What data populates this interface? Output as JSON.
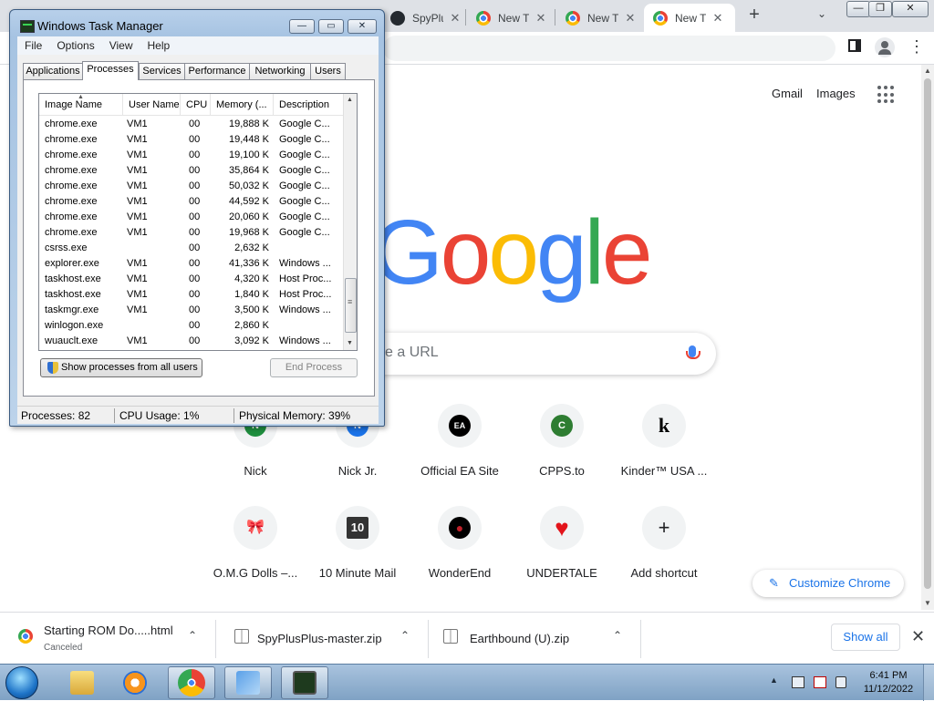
{
  "browser": {
    "tabs": [
      {
        "title": "SpyPlu",
        "icon": "github-icon",
        "active": false
      },
      {
        "title": "New T",
        "icon": "chrome-icon",
        "active": false
      },
      {
        "title": "New T",
        "icon": "chrome-icon",
        "active": false
      },
      {
        "title": "New T",
        "icon": "chrome-icon",
        "active": true
      }
    ],
    "new_tab": "+",
    "tab_close": "✕",
    "tab_search": "⌄",
    "window_controls": {
      "minimize": "—",
      "maximize": "❐",
      "close": "✕"
    },
    "menu": "⋮"
  },
  "ntp": {
    "gmail": "Gmail",
    "images": "Images",
    "logo_letters": [
      {
        "ch": "G",
        "color": "#4285f4"
      },
      {
        "ch": "o",
        "color": "#ea4335"
      },
      {
        "ch": "o",
        "color": "#fbbc05"
      },
      {
        "ch": "g",
        "color": "#4285f4"
      },
      {
        "ch": "l",
        "color": "#34a853"
      },
      {
        "ch": "e",
        "color": "#ea4335"
      }
    ],
    "search_placeholder": "e a URL",
    "shortcuts": [
      {
        "label": "Nick",
        "icon": "n-letter-icon",
        "letter": "N",
        "color": "#1e8e3e"
      },
      {
        "label": "Nick Jr.",
        "icon": "nick-jr-icon",
        "letter": "N",
        "color": "#1a73e8"
      },
      {
        "label": "Official EA Site",
        "icon": "ea-icon",
        "letter": "EA",
        "color": "#000000"
      },
      {
        "label": "CPPS.to",
        "icon": "c-letter-icon",
        "letter": "C",
        "color": "#2e7d32"
      },
      {
        "label": "Kinder™ USA ...",
        "icon": "kinder-icon",
        "letter": "k",
        "color": "#000000"
      },
      {
        "label": "O.M.G Dolls –...",
        "icon": "doll-icon",
        "letter": "🎀",
        "color": "#ffffff"
      },
      {
        "label": "10 Minute Mail",
        "icon": "ten-minute-mail-icon",
        "letter": "10",
        "color": "#333333"
      },
      {
        "label": "WonderEnd",
        "icon": "wonderend-icon",
        "letter": "●",
        "color": "#000000"
      },
      {
        "label": "UNDERTALE",
        "icon": "heart-icon",
        "letter": "♥",
        "color": "#ffffff"
      },
      {
        "label": "Add shortcut",
        "icon": "plus-icon",
        "letter": "+",
        "color": "#ffffff"
      }
    ],
    "customize": "Customize Chrome"
  },
  "downloads": {
    "items": [
      {
        "name": "Starting ROM Do.....html",
        "status": "Canceled"
      },
      {
        "name": "SpyPlusPlus-master.zip",
        "status": ""
      },
      {
        "name": "Earthbound (U).zip",
        "status": ""
      }
    ],
    "chevron": "⌃",
    "show_all": "Show all",
    "close": "✕"
  },
  "taskbar": {
    "clock_time": "6:41 PM",
    "clock_date": "11/12/2022",
    "tray_arrow": "▲"
  },
  "taskmgr": {
    "title": "Windows Task Manager",
    "controls": {
      "minimize": "—",
      "maximize": "▭",
      "close": "✕"
    },
    "menu": [
      "File",
      "Options",
      "View",
      "Help"
    ],
    "tabs": [
      "Applications",
      "Processes",
      "Services",
      "Performance",
      "Networking",
      "Users"
    ],
    "active_tab": "Processes",
    "columns": [
      "Image Name",
      "User Name",
      "CPU",
      "Memory (...",
      "Description"
    ],
    "sort_arrow": "▲",
    "processes": [
      {
        "name": "chrome.exe",
        "user": "VM1",
        "cpu": "00",
        "mem": "19,888 K",
        "desc": "Google C..."
      },
      {
        "name": "chrome.exe",
        "user": "VM1",
        "cpu": "00",
        "mem": "19,448 K",
        "desc": "Google C..."
      },
      {
        "name": "chrome.exe",
        "user": "VM1",
        "cpu": "00",
        "mem": "19,100 K",
        "desc": "Google C..."
      },
      {
        "name": "chrome.exe",
        "user": "VM1",
        "cpu": "00",
        "mem": "35,864 K",
        "desc": "Google C..."
      },
      {
        "name": "chrome.exe",
        "user": "VM1",
        "cpu": "00",
        "mem": "50,032 K",
        "desc": "Google C..."
      },
      {
        "name": "chrome.exe",
        "user": "VM1",
        "cpu": "00",
        "mem": "44,592 K",
        "desc": "Google C..."
      },
      {
        "name": "chrome.exe",
        "user": "VM1",
        "cpu": "00",
        "mem": "20,060 K",
        "desc": "Google C..."
      },
      {
        "name": "chrome.exe",
        "user": "VM1",
        "cpu": "00",
        "mem": "19,968 K",
        "desc": "Google C..."
      },
      {
        "name": "csrss.exe",
        "user": "",
        "cpu": "00",
        "mem": "2,632 K",
        "desc": ""
      },
      {
        "name": "explorer.exe",
        "user": "VM1",
        "cpu": "00",
        "mem": "41,336 K",
        "desc": "Windows ..."
      },
      {
        "name": "taskhost.exe",
        "user": "VM1",
        "cpu": "00",
        "mem": "4,320 K",
        "desc": "Host Proc..."
      },
      {
        "name": "taskhost.exe",
        "user": "VM1",
        "cpu": "00",
        "mem": "1,840 K",
        "desc": "Host Proc..."
      },
      {
        "name": "taskmgr.exe",
        "user": "VM1",
        "cpu": "00",
        "mem": "3,500 K",
        "desc": "Windows ..."
      },
      {
        "name": "winlogon.exe",
        "user": "",
        "cpu": "00",
        "mem": "2,860 K",
        "desc": ""
      },
      {
        "name": "wuauclt.exe",
        "user": "VM1",
        "cpu": "00",
        "mem": "3,092 K",
        "desc": "Windows ..."
      }
    ],
    "show_all_processes": "Show processes from all users",
    "end_process": "End Process",
    "status": {
      "processes": "Processes: 82",
      "cpu": "CPU Usage: 1%",
      "memory": "Physical Memory: 39%"
    }
  }
}
